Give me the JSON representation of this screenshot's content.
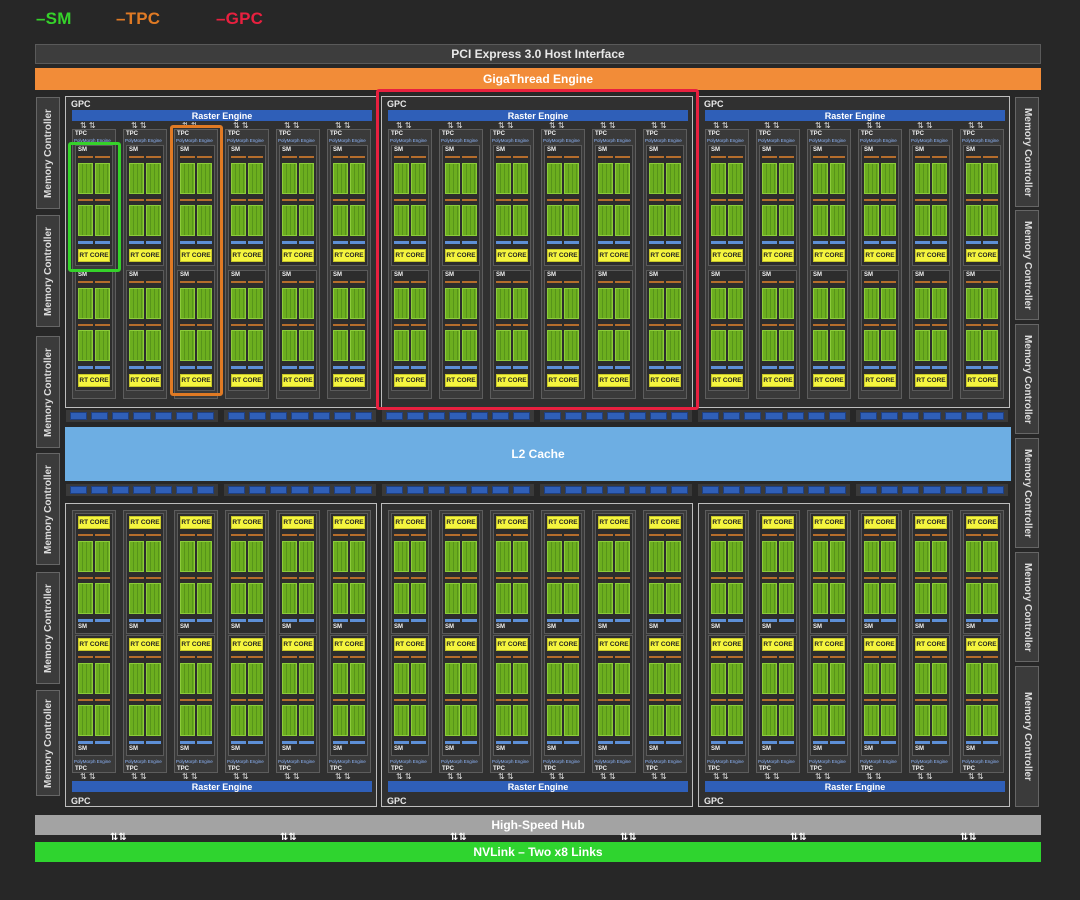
{
  "legend": {
    "sm": {
      "text": "–SM",
      "color": "#35d22a"
    },
    "tpc": {
      "text": "–TPC",
      "color": "#e07a24"
    },
    "gpc": {
      "text": "–GPC",
      "color": "#e8203f"
    }
  },
  "bars": {
    "pcie": "PCI Express 3.0 Host Interface",
    "gigathread": "GigaThread Engine",
    "l2": "L2 Cache",
    "hub": "High-Speed Hub",
    "nvlink": "NVLink – Two x8 Links"
  },
  "memory_controller": "Memory Controller",
  "gpc_label": "GPC",
  "raster_engine": "Raster Engine",
  "tpc_label": "TPC",
  "polymorph": "PolyMorph Engine",
  "sm_label": "SM",
  "rt_core": "RT CORE",
  "arrow_glyph": "⇅",
  "colors": {
    "background": "#272727",
    "sm_block": "#6cae1f",
    "rt_core": "#f5f53e",
    "raster": "#2f5fb8",
    "l2": "#6daee3",
    "gigathread": "#f28c38",
    "nvlink": "#2fd42f"
  }
}
